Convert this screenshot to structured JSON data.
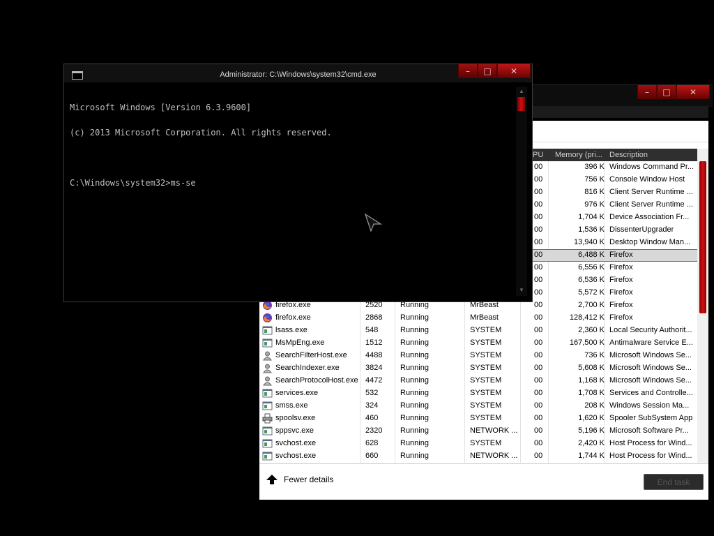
{
  "cmd": {
    "title": "Administrator: C:\\Windows\\system32\\cmd.exe",
    "lines": [
      "Microsoft Windows [Version 6.3.9600]",
      "(c) 2013 Microsoft Corporation. All rights reserved.",
      "",
      "C:\\Windows\\system32>ms-se"
    ],
    "caption": {
      "min": "–",
      "max": "□",
      "close": "✕"
    }
  },
  "taskmanager": {
    "caption": {
      "min": "–",
      "max": "□",
      "close": "✕"
    },
    "headers": {
      "cpu": "PU",
      "memory": "Memory (pri...",
      "description": "Description"
    },
    "rows": [
      {
        "name": "",
        "pid": "",
        "status": "",
        "user": "",
        "cpu": "00",
        "memory": "396 K",
        "description": "Windows Command Pr...",
        "icon": ""
      },
      {
        "name": "",
        "pid": "",
        "status": "",
        "user": "",
        "cpu": "00",
        "memory": "756 K",
        "description": "Console Window Host",
        "icon": ""
      },
      {
        "name": "",
        "pid": "",
        "status": "",
        "user": "",
        "cpu": "00",
        "memory": "816 K",
        "description": "Client Server Runtime ...",
        "icon": ""
      },
      {
        "name": "",
        "pid": "",
        "status": "",
        "user": "",
        "cpu": "00",
        "memory": "976 K",
        "description": "Client Server Runtime ...",
        "icon": ""
      },
      {
        "name": "",
        "pid": "",
        "status": "",
        "user": "",
        "cpu": "00",
        "memory": "1,704 K",
        "description": "Device Association Fr...",
        "icon": ""
      },
      {
        "name": "",
        "pid": "",
        "status": "",
        "user": "",
        "cpu": "00",
        "memory": "1,536 K",
        "description": "DissenterUpgrader",
        "icon": ""
      },
      {
        "name": "",
        "pid": "",
        "status": "",
        "user": "",
        "cpu": "00",
        "memory": "13,940 K",
        "description": "Desktop Window Man...",
        "icon": ""
      },
      {
        "name": "",
        "pid": "",
        "status": "",
        "user": "",
        "cpu": "00",
        "memory": "6,488 K",
        "description": "Firefox",
        "icon": "",
        "selected": true
      },
      {
        "name": "",
        "pid": "",
        "status": "",
        "user": "",
        "cpu": "00",
        "memory": "6,556 K",
        "description": "Firefox",
        "icon": ""
      },
      {
        "name": "",
        "pid": "",
        "status": "",
        "user": "",
        "cpu": "00",
        "memory": "6,536 K",
        "description": "Firefox",
        "icon": ""
      },
      {
        "name": "",
        "pid": "",
        "status": "",
        "user": "",
        "cpu": "00",
        "memory": "5,572 K",
        "description": "Firefox",
        "icon": ""
      },
      {
        "name": "firefox.exe",
        "pid": "2520",
        "status": "Running",
        "user": "MrBeast",
        "cpu": "00",
        "memory": "2,700 K",
        "description": "Firefox",
        "icon": "firefox-icon"
      },
      {
        "name": "firefox.exe",
        "pid": "2868",
        "status": "Running",
        "user": "MrBeast",
        "cpu": "00",
        "memory": "128,412 K",
        "description": "Firefox",
        "icon": "firefox-icon"
      },
      {
        "name": "lsass.exe",
        "pid": "548",
        "status": "Running",
        "user": "SYSTEM",
        "cpu": "00",
        "memory": "2,360 K",
        "description": "Local Security Authorit...",
        "icon": "app-window-icon"
      },
      {
        "name": "MsMpEng.exe",
        "pid": "1512",
        "status": "Running",
        "user": "SYSTEM",
        "cpu": "00",
        "memory": "167,500 K",
        "description": "Antimalware Service E...",
        "icon": "app-window-icon"
      },
      {
        "name": "SearchFilterHost.exe",
        "pid": "4488",
        "status": "Running",
        "user": "SYSTEM",
        "cpu": "00",
        "memory": "736 K",
        "description": "Microsoft Windows Se...",
        "icon": "search-user-icon"
      },
      {
        "name": "SearchIndexer.exe",
        "pid": "3824",
        "status": "Running",
        "user": "SYSTEM",
        "cpu": "00",
        "memory": "5,608 K",
        "description": "Microsoft Windows Se...",
        "icon": "search-user-icon"
      },
      {
        "name": "SearchProtocolHost.exe",
        "pid": "4472",
        "status": "Running",
        "user": "SYSTEM",
        "cpu": "00",
        "memory": "1,168 K",
        "description": "Microsoft Windows Se...",
        "icon": "search-user-icon"
      },
      {
        "name": "services.exe",
        "pid": "532",
        "status": "Running",
        "user": "SYSTEM",
        "cpu": "00",
        "memory": "1,708 K",
        "description": "Services and Controlle...",
        "icon": "app-window-icon"
      },
      {
        "name": "smss.exe",
        "pid": "324",
        "status": "Running",
        "user": "SYSTEM",
        "cpu": "00",
        "memory": "208 K",
        "description": "Windows Session Ma...",
        "icon": "app-window-icon"
      },
      {
        "name": "spoolsv.exe",
        "pid": "460",
        "status": "Running",
        "user": "SYSTEM",
        "cpu": "00",
        "memory": "1,620 K",
        "description": "Spooler SubSystem App",
        "icon": "printer-icon"
      },
      {
        "name": "sppsvc.exe",
        "pid": "2320",
        "status": "Running",
        "user": "NETWORK ...",
        "cpu": "00",
        "memory": "5,196 K",
        "description": "Microsoft Software Pr...",
        "icon": "app-window-icon"
      },
      {
        "name": "svchost.exe",
        "pid": "628",
        "status": "Running",
        "user": "SYSTEM",
        "cpu": "00",
        "memory": "2,420 K",
        "description": "Host Process for Wind...",
        "icon": "app-window-icon"
      },
      {
        "name": "svchost.exe",
        "pid": "660",
        "status": "Running",
        "user": "NETWORK ...",
        "cpu": "00",
        "memory": "1,744 K",
        "description": "Host Process for Wind...",
        "icon": "app-window-icon"
      }
    ],
    "footer": {
      "fewer_details": "Fewer details",
      "end_task": "End task"
    }
  }
}
